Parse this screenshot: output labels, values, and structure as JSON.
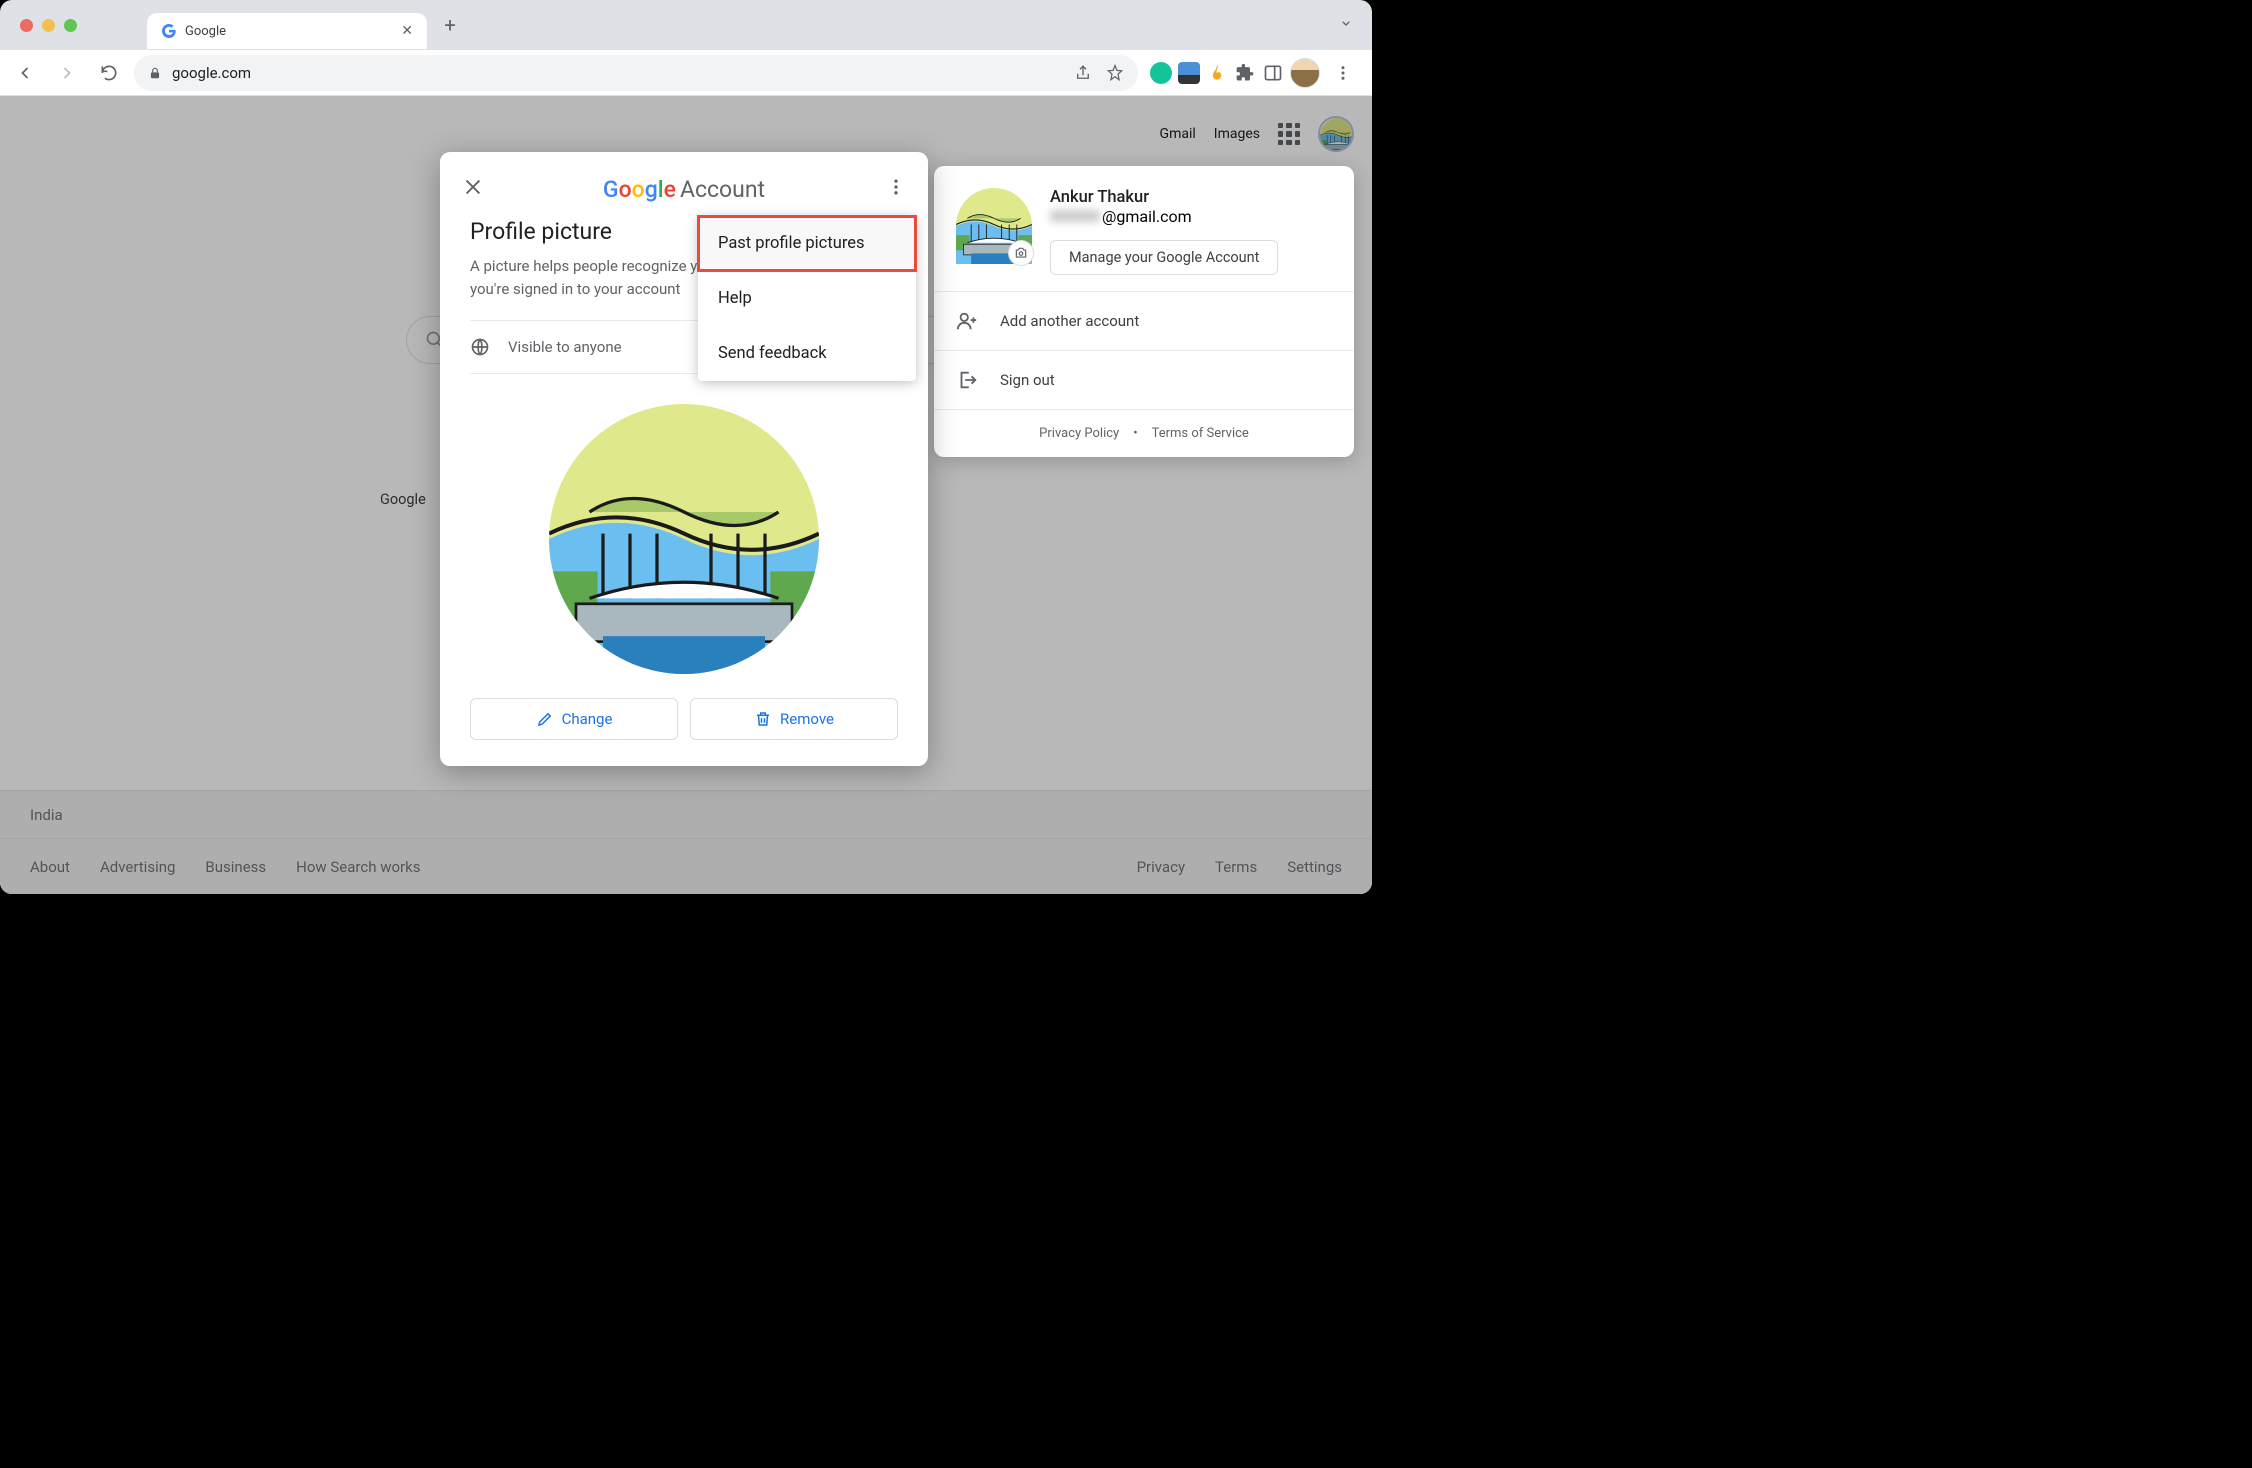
{
  "browser": {
    "tab_title": "Google",
    "url": "google.com",
    "new_tab_label": "+",
    "expand_label": "⌄"
  },
  "page": {
    "header_links": {
      "gmail": "Gmail",
      "images": "Images"
    },
    "search_placeholder": "",
    "button_hint": "Google",
    "footer_location": "India",
    "footer_left": [
      "About",
      "Advertising",
      "Business",
      "How Search works"
    ],
    "footer_right": [
      "Privacy",
      "Terms",
      "Settings"
    ]
  },
  "account_popover": {
    "name": "Ankur Thakur",
    "email_suffix": "@gmail.com",
    "manage_button": "Manage your Google Account",
    "add_account": "Add another account",
    "sign_out": "Sign out",
    "privacy": "Privacy Policy",
    "tos": "Terms of Service"
  },
  "modal": {
    "brand": "Google",
    "title_suffix": "Account",
    "heading": "Profile picture",
    "description": "A picture helps people recognize you and lets you know when you're signed in to your account",
    "visibility": "Visible to anyone",
    "change_label": "Change",
    "remove_label": "Remove"
  },
  "dropdown": {
    "past": "Past profile pictures",
    "help": "Help",
    "feedback": "Send feedback"
  }
}
